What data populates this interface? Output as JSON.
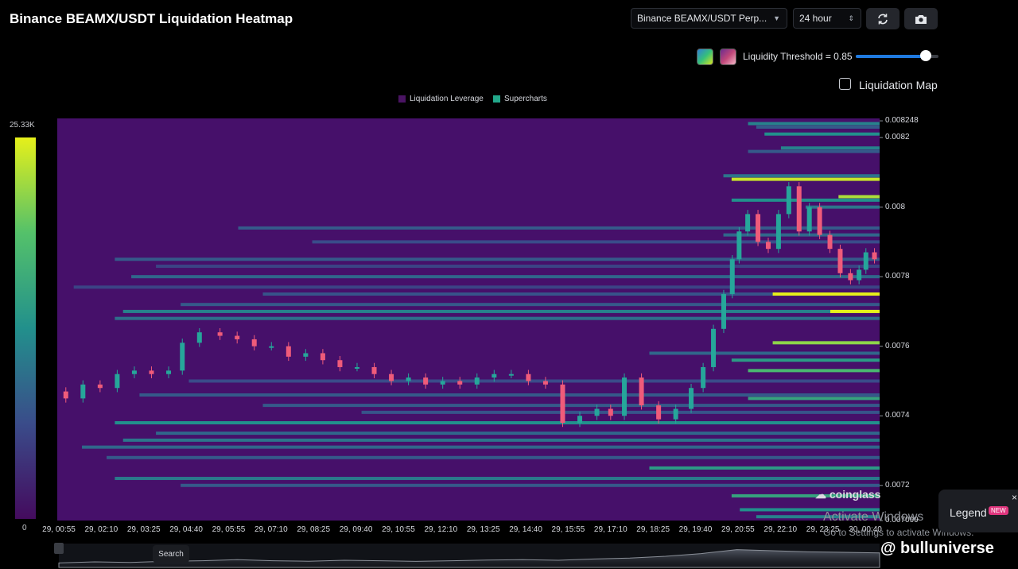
{
  "header": {
    "title": "Binance BEAMX/USDT Liquidation Heatmap",
    "pair_select": "Binance BEAMX/USDT Perp...",
    "interval_select": "24 hour"
  },
  "controls": {
    "threshold_label": "Liquidity Threshold = 0.85",
    "threshold_value": 0.85,
    "liquidation_map_label": "Liquidation Map",
    "liquidation_map_checked": false
  },
  "legend": {
    "items": [
      {
        "label": "Liquidation Leverage",
        "color": "#4a1463"
      },
      {
        "label": "Supercharts",
        "color": "#22a88a"
      }
    ]
  },
  "colorscale": {
    "max_label": "25.33K",
    "min_label": "0"
  },
  "legend_button": {
    "label": "Legend",
    "badge": "NEW",
    "close": "×"
  },
  "watermark": {
    "logo": "coinglass",
    "activate_line1": "Activate Windows",
    "activate_line2": "Go to Settings to activate Windows.",
    "brand": "@ bulluniverse"
  },
  "navigator": {
    "search_label": "Search"
  },
  "colors": {
    "background": "#000000",
    "heat_low": "#46106a",
    "heat_high": "#e6f01a"
  },
  "chart_data": {
    "type": "heatmap",
    "title": "Binance BEAMX/USDT Liquidation Heatmap",
    "ylim": [
      0.007099,
      0.008255
    ],
    "y_ticks": [
      "0.008248",
      "0.0082",
      "0.008",
      "0.0078",
      "0.0076",
      "0.0074",
      "0.0072",
      "0.007099"
    ],
    "y_tick_values": [
      0.008248,
      0.0082,
      0.008,
      0.0078,
      0.0076,
      0.0074,
      0.0072,
      0.007099
    ],
    "x_ticks": [
      "29, 00:55",
      "29, 02:10",
      "29, 03:25",
      "29, 04:40",
      "29, 05:55",
      "29, 07:10",
      "29, 08:25",
      "29, 09:40",
      "29, 10:55",
      "29, 12:10",
      "29, 13:25",
      "29, 14:40",
      "29, 15:55",
      "29, 17:10",
      "29, 18:25",
      "29, 19:40",
      "29, 20:55",
      "29, 22:10",
      "29, 23:25",
      "30, 00:40"
    ],
    "x_range_hours": [
      0,
      24
    ],
    "liquidation_bands": [
      {
        "price": 0.00824,
        "start": 0.84,
        "intensity": 0.45
      },
      {
        "price": 0.00823,
        "start": 0.85,
        "intensity": 0.3
      },
      {
        "price": 0.00821,
        "start": 0.86,
        "intensity": 0.5
      },
      {
        "price": 0.00817,
        "start": 0.88,
        "intensity": 0.45
      },
      {
        "price": 0.00816,
        "start": 0.84,
        "intensity": 0.3
      },
      {
        "price": 0.00809,
        "start": 0.81,
        "intensity": 0.4
      },
      {
        "price": 0.00808,
        "start": 0.82,
        "intensity": 0.95
      },
      {
        "price": 0.00803,
        "start": 0.95,
        "intensity": 0.9
      },
      {
        "price": 0.00802,
        "start": 0.82,
        "intensity": 0.5
      },
      {
        "price": 0.008,
        "start": 0.91,
        "intensity": 0.4
      },
      {
        "price": 0.00794,
        "start": 0.22,
        "intensity": 0.3
      },
      {
        "price": 0.00792,
        "start": 0.81,
        "intensity": 0.35
      },
      {
        "price": 0.0079,
        "start": 0.31,
        "intensity": 0.25
      },
      {
        "price": 0.00785,
        "start": 0.07,
        "intensity": 0.3
      },
      {
        "price": 0.00783,
        "start": 0.12,
        "intensity": 0.22
      },
      {
        "price": 0.0078,
        "start": 0.09,
        "intensity": 0.35
      },
      {
        "price": 0.00777,
        "start": 0.02,
        "intensity": 0.22
      },
      {
        "price": 0.00775,
        "start": 0.25,
        "intensity": 0.28
      },
      {
        "price": 0.00775,
        "start": 0.87,
        "intensity": 1.0
      },
      {
        "price": 0.00772,
        "start": 0.15,
        "intensity": 0.3
      },
      {
        "price": 0.0077,
        "start": 0.08,
        "intensity": 0.45
      },
      {
        "price": 0.0077,
        "start": 0.94,
        "intensity": 1.0
      },
      {
        "price": 0.00768,
        "start": 0.07,
        "intensity": 0.38
      },
      {
        "price": 0.00761,
        "start": 0.87,
        "intensity": 0.85
      },
      {
        "price": 0.00758,
        "start": 0.72,
        "intensity": 0.35
      },
      {
        "price": 0.00756,
        "start": 0.82,
        "intensity": 0.55
      },
      {
        "price": 0.00753,
        "start": 0.84,
        "intensity": 0.7
      },
      {
        "price": 0.0075,
        "start": 0.16,
        "intensity": 0.25
      },
      {
        "price": 0.00746,
        "start": 0.1,
        "intensity": 0.3
      },
      {
        "price": 0.00745,
        "start": 0.84,
        "intensity": 0.6
      },
      {
        "price": 0.00743,
        "start": 0.25,
        "intensity": 0.3
      },
      {
        "price": 0.00741,
        "start": 0.37,
        "intensity": 0.28
      },
      {
        "price": 0.00738,
        "start": 0.07,
        "intensity": 0.5
      },
      {
        "price": 0.00735,
        "start": 0.12,
        "intensity": 0.35
      },
      {
        "price": 0.00733,
        "start": 0.08,
        "intensity": 0.4
      },
      {
        "price": 0.00731,
        "start": 0.03,
        "intensity": 0.35
      },
      {
        "price": 0.00728,
        "start": 0.06,
        "intensity": 0.3
      },
      {
        "price": 0.00725,
        "start": 0.72,
        "intensity": 0.55
      },
      {
        "price": 0.00722,
        "start": 0.07,
        "intensity": 0.42
      },
      {
        "price": 0.0072,
        "start": 0.15,
        "intensity": 0.3
      },
      {
        "price": 0.00717,
        "start": 0.82,
        "intensity": 0.6
      },
      {
        "price": 0.00713,
        "start": 0.83,
        "intensity": 0.5
      },
      {
        "price": 0.00711,
        "start": 0.85,
        "intensity": 0.45
      }
    ],
    "price_series": {
      "time": [
        0.0,
        0.5,
        1.0,
        1.5,
        2.0,
        2.5,
        3.0,
        3.5,
        3.8,
        4.5,
        5.0,
        5.5,
        6.0,
        6.5,
        7.0,
        7.5,
        8.0,
        8.5,
        9.0,
        9.5,
        10.0,
        10.5,
        11.0,
        11.5,
        12.0,
        12.5,
        13.0,
        13.5,
        14.0,
        14.5,
        15.0,
        15.5,
        16.0,
        16.3,
        16.8,
        17.3,
        17.8,
        18.3,
        18.7,
        19.0,
        19.3,
        19.6,
        19.8,
        20.0,
        20.3,
        20.6,
        20.9,
        21.2,
        21.5,
        21.8,
        22.1,
        22.4,
        22.7,
        23.0,
        23.3,
        23.5,
        23.7,
        24.0
      ],
      "price": [
        0.00747,
        0.00745,
        0.00749,
        0.00748,
        0.00752,
        0.00753,
        0.00752,
        0.00753,
        0.00761,
        0.00764,
        0.00763,
        0.00762,
        0.0076,
        0.0076,
        0.00757,
        0.00758,
        0.00756,
        0.00754,
        0.00754,
        0.00752,
        0.0075,
        0.00751,
        0.00749,
        0.0075,
        0.00749,
        0.00751,
        0.00752,
        0.00752,
        0.0075,
        0.00749,
        0.00738,
        0.0074,
        0.00742,
        0.0074,
        0.00751,
        0.00743,
        0.00739,
        0.00742,
        0.00748,
        0.00754,
        0.00765,
        0.00775,
        0.00785,
        0.00793,
        0.00798,
        0.0079,
        0.00788,
        0.00798,
        0.00806,
        0.00793,
        0.008,
        0.00792,
        0.00788,
        0.00781,
        0.00779,
        0.00782,
        0.00787,
        0.00785
      ]
    },
    "navigator_volume": [
      0.2,
      0.25,
      0.22,
      0.28,
      0.3,
      0.35,
      0.3,
      0.28,
      0.32,
      0.3,
      0.27,
      0.3,
      0.33,
      0.35,
      0.32,
      0.38,
      0.42,
      0.5,
      0.62,
      0.8,
      0.75,
      0.7,
      0.68,
      0.65
    ]
  }
}
